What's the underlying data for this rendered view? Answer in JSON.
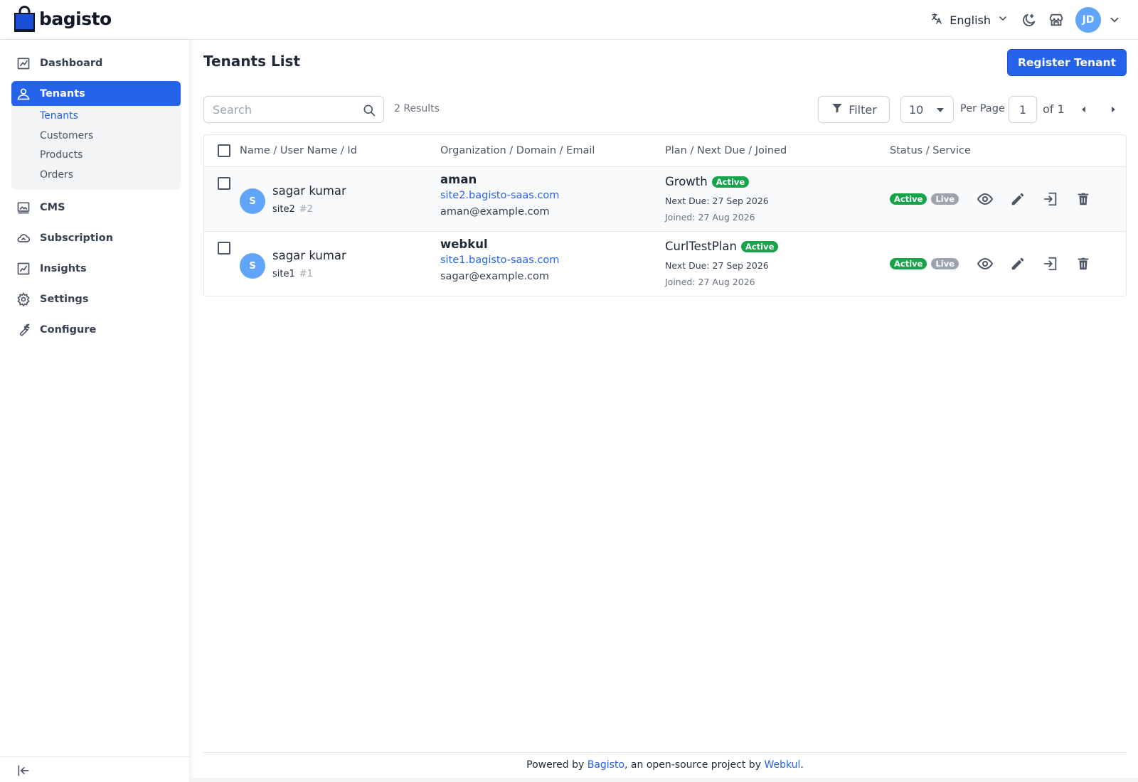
{
  "header": {
    "brand": "bagisto",
    "language": "English",
    "user_initials": "JD",
    "accent": "#2563eb"
  },
  "sidebar": {
    "items": [
      {
        "label": "Dashboard",
        "icon": "dashboard-icon"
      },
      {
        "label": "Tenants",
        "icon": "user-icon",
        "active": true
      },
      {
        "label": "CMS",
        "icon": "cms-icon"
      },
      {
        "label": "Subscription",
        "icon": "cloud-icon"
      },
      {
        "label": "Insights",
        "icon": "insights-icon"
      },
      {
        "label": "Settings",
        "icon": "gear-icon"
      },
      {
        "label": "Configure",
        "icon": "wrench-icon"
      }
    ],
    "sub_items": [
      {
        "label": "Tenants",
        "active": true
      },
      {
        "label": "Customers"
      },
      {
        "label": "Products"
      },
      {
        "label": "Orders"
      }
    ]
  },
  "main": {
    "title": "Tenants List",
    "register_button": "Register Tenant",
    "search_placeholder": "Search",
    "results": "2 Results",
    "filter_label": "Filter",
    "per_page_value": "10",
    "per_page_label": "Per Page",
    "current_page": "1",
    "of_pages": "of 1"
  },
  "table": {
    "columns": [
      "Name / User Name / Id",
      "Organization / Domain / Email",
      "Plan / Next Due / Joined",
      "Status / Service"
    ],
    "rows": [
      {
        "avatar": "S",
        "name": "sagar kumar",
        "username": "site2",
        "id": "#2",
        "org": "aman",
        "domain": "site2.bagisto-saas.com",
        "email": "aman@example.com",
        "plan": "Growth",
        "plan_status": "Active",
        "next_due": "Next Due: 27 Sep 2026",
        "joined": "Joined: 27 Aug 2026",
        "status": "Active",
        "service": "Live"
      },
      {
        "avatar": "S",
        "name": "sagar kumar",
        "username": "site1",
        "id": "#1",
        "org": "webkul",
        "domain": "site1.bagisto-saas.com",
        "email": "sagar@example.com",
        "plan": "CurlTestPlan",
        "plan_status": "Active",
        "next_due": "Next Due: 27 Sep 2026",
        "joined": "Joined: 27 Aug 2026",
        "status": "Active",
        "service": "Live"
      }
    ]
  },
  "footer": {
    "prefix": "Powered by ",
    "link1": "Bagisto",
    "middle": ", an open-source project by ",
    "link2": "Webkul",
    "suffix": "."
  }
}
